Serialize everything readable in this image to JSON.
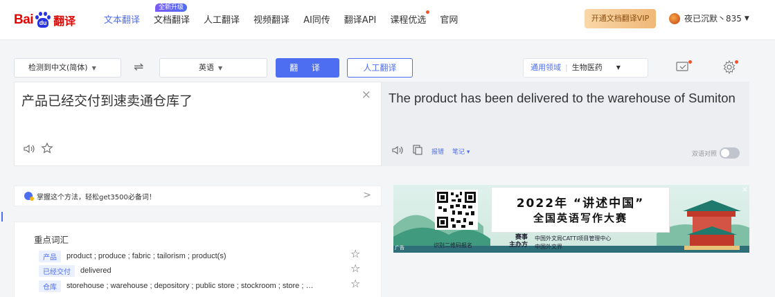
{
  "logo": {
    "text_left": "Bai",
    "paw_text": "du",
    "text_right": "翻译"
  },
  "nav": {
    "items": [
      {
        "label": "文本翻译",
        "active": true
      },
      {
        "label": "文档翻译",
        "badge": "全新升级"
      },
      {
        "label": "人工翻译"
      },
      {
        "label": "视频翻译"
      },
      {
        "label": "AI同传"
      },
      {
        "label": "翻译API"
      },
      {
        "label": "课程优选",
        "dot": true
      },
      {
        "label": "官网"
      }
    ],
    "vip_label": "开通文档翻译VIP",
    "user_name": "夜已沉默丶835"
  },
  "controls": {
    "source_lang": "检测到中文(简体)",
    "target_lang": "英语",
    "translate_label": "翻 译",
    "human_label": "人工翻译",
    "domain_label": "通用领域",
    "domain_value": "生物医药"
  },
  "source": {
    "text": "产品已经交付到速卖通仓库了"
  },
  "target": {
    "text": "The product has been delivered to the warehouse of Sumiton",
    "report_label": "报错",
    "note_label": "笔记",
    "bilingual_label": "双语对照"
  },
  "tip": {
    "text": "掌握这个方法，轻松get3500必备词！"
  },
  "vocab": {
    "title": "重点词汇",
    "rows": [
      {
        "term": "产品",
        "def": "product ; produce ; fabric ; tailorism ; product(s)"
      },
      {
        "term": "已经交付",
        "def": "delivered"
      },
      {
        "term": "仓库",
        "def": "storehouse ; warehouse ; depository ; public store ; stockroom ; store ; …"
      }
    ]
  },
  "ad": {
    "title_line1": "2022年 “讲述中国”",
    "title_line2": "全国英语写作大赛",
    "qr_caption": "识别二维码报名",
    "host_label": "赛事\n主办方",
    "host_org1": "中国外文局CATTI项目管理中心",
    "host_org2": "中国外文界",
    "ad_tag": "广告",
    "close": "×"
  },
  "colors": {
    "accent": "#4e6ef2",
    "brand_red": "#e10601",
    "vip_gold": "#efb877"
  }
}
